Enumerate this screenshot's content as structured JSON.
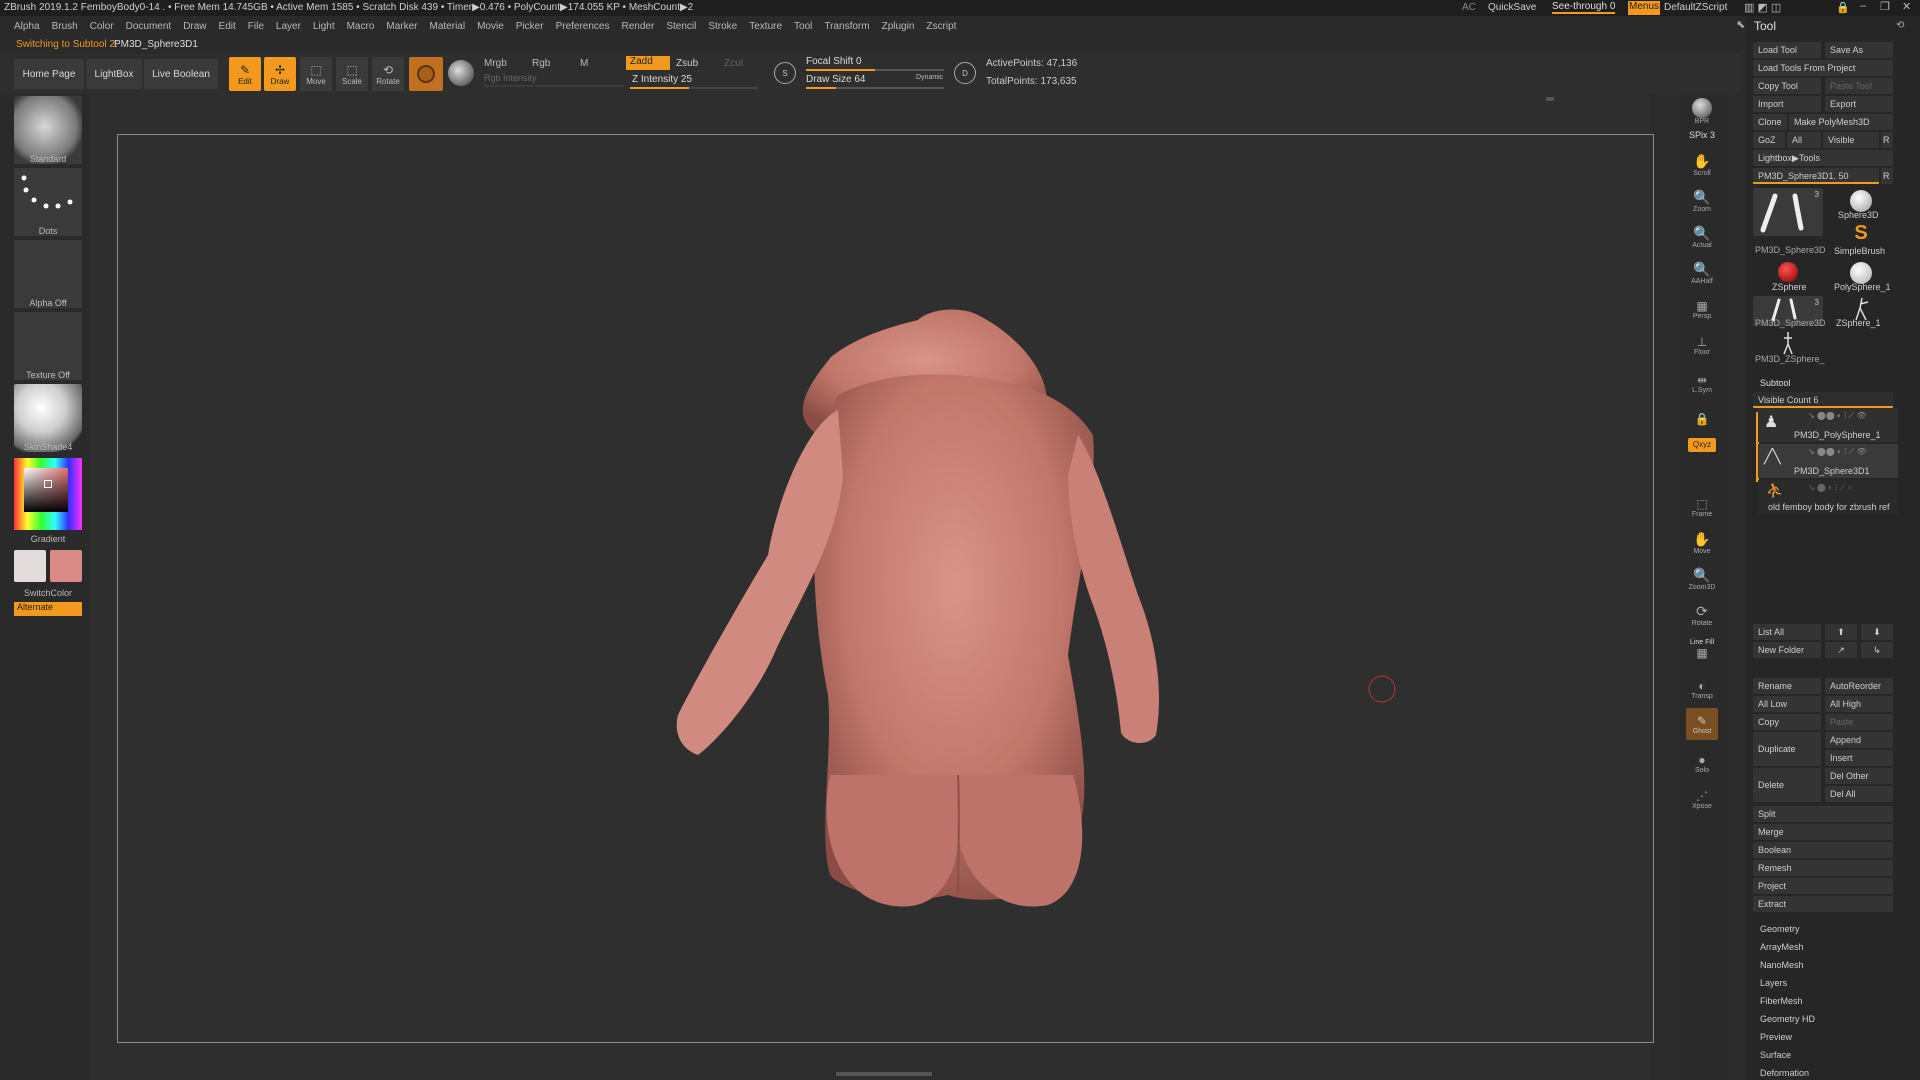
{
  "titlebar": {
    "title": "ZBrush 2019.1.2   FemboyBody0-14  . • Free Mem 14.745GB • Active Mem 1585 • Scratch Disk 439 • Timer▶0.476 • PolyCount▶174.055 KP • MeshCount▶2",
    "ac": "AC",
    "quicksave": "QuickSave",
    "seethrough": "See-through  0",
    "menus": "Menus",
    "defaultzscript": "DefaultZScript",
    "colors": {
      "accent": "#f39a1e",
      "bg": "#2b2b2b",
      "panel": "#262626"
    }
  },
  "menubar": [
    "Alpha",
    "Brush",
    "Color",
    "Document",
    "Draw",
    "Edit",
    "File",
    "Layer",
    "Light",
    "Macro",
    "Marker",
    "Material",
    "Movie",
    "Picker",
    "Preferences",
    "Render",
    "Stencil",
    "Stroke",
    "Texture",
    "Tool",
    "Transform",
    "Zplugin",
    "Zscript"
  ],
  "status": {
    "prefix": "Switching to Subtool 2:",
    "name": "PM3D_Sphere3D1"
  },
  "toolbar": {
    "home": "Home Page",
    "lightbox": "LightBox",
    "liveboolean": "Live Boolean",
    "edit": "Edit",
    "draw": "Draw",
    "move": "Move",
    "scale": "Scale",
    "rotate": "Rotate",
    "mrgb": "Mrgb",
    "rgb": "Rgb",
    "m": "M",
    "rgb_intensity": "Rgb Intensity",
    "zadd": "Zadd",
    "zsub": "Zsub",
    "zcut": "Zcut",
    "z_intensity": "Z Intensity 25",
    "z_intensity_value": 25,
    "focal_shift": "Focal Shift 0",
    "draw_size": "Draw Size 64",
    "draw_size_value": 64,
    "dynamic": "Dynamic",
    "active_points": "ActivePoints: 47,136",
    "total_points": "TotalPoints: 173,635"
  },
  "leftpanel": {
    "brush": "Standard",
    "stroke": "Dots",
    "alpha": "Alpha Off",
    "texture": "Texture Off",
    "material": "SkinShade4",
    "gradient": "Gradient",
    "switchcolor": "SwitchColor",
    "alternate": "Alternate"
  },
  "rightshelf": [
    {
      "icon": "bpr-icon",
      "label": "BPR"
    },
    {
      "icon": "spix-icon",
      "label": "SPix 3"
    },
    {
      "icon": "scroll-icon",
      "label": "Scroll"
    },
    {
      "icon": "zoom-icon",
      "label": "Zoom"
    },
    {
      "icon": "actual-icon",
      "label": "Actual"
    },
    {
      "icon": "aahalf-icon",
      "label": "AAHalf"
    },
    {
      "icon": "persp-icon",
      "label": "Persp"
    },
    {
      "icon": "floor-icon",
      "label": "Floor"
    },
    {
      "icon": "lsym-icon",
      "label": "L.Sym"
    },
    {
      "icon": "lock-icon",
      "label": ""
    },
    {
      "icon": "xyz-icon",
      "label": "Qxyz"
    },
    {
      "icon": "frame-icon",
      "label": "Frame"
    },
    {
      "icon": "move-icon",
      "label": "Move"
    },
    {
      "icon": "zoom3d-icon",
      "label": "Zoom3D"
    },
    {
      "icon": "rotate-icon",
      "label": "Rotate"
    },
    {
      "icon": "linefill-icon",
      "label": "Line Fill"
    },
    {
      "icon": "transp-icon",
      "label": "Transp"
    },
    {
      "icon": "ghost-icon",
      "label": "Ghost"
    },
    {
      "icon": "solo-icon",
      "label": "Solo"
    },
    {
      "icon": "xpose-icon",
      "label": "Xpose"
    }
  ],
  "toolpanel": {
    "title": "Tool",
    "load_tool": "Load Tool",
    "save_as": "Save As",
    "load_from_project": "Load Tools From Project",
    "copy_tool": "Copy Tool",
    "paste_tool": "Paste Tool",
    "import": "Import",
    "export": "Export",
    "clone": "Clone",
    "make_polymesh": "Make PolyMesh3D",
    "goz": "GoZ",
    "all": "All",
    "visible": "Visible",
    "r": "R",
    "lightbox_tools": "Lightbox▶Tools",
    "current_tool": "PM3D_Sphere3D1. 50",
    "tools": [
      {
        "name": "PM3D_Sphere3D",
        "count": "3"
      },
      {
        "name": "Sphere3D",
        "count": ""
      },
      {
        "name": "SimpleBrush",
        "count": ""
      },
      {
        "name": "ZSphere",
        "count": ""
      },
      {
        "name": "PolySphere_1",
        "count": ""
      },
      {
        "name": "PM3D_Sphere3D",
        "count": "3"
      },
      {
        "name": "ZSphere_1",
        "count": ""
      },
      {
        "name": "PM3D_ZSphere_",
        "count": ""
      }
    ],
    "subtool_title": "Subtool",
    "visible_count": "Visible Count 6",
    "subtools": [
      "PM3D_PolySphere_1",
      "PM3D_Sphere3D1",
      "old femboy body for zbrush ref"
    ],
    "list_all": "List All",
    "new_folder": "New Folder",
    "rename": "Rename",
    "autoreorder": "AutoReorder",
    "all_low": "All Low",
    "all_high": "All High",
    "copy": "Copy",
    "paste": "Paste",
    "duplicate": "Duplicate",
    "append": "Append",
    "insert": "Insert",
    "delete": "Delete",
    "del_other": "Del Other",
    "del_all": "Del All",
    "split": "Split",
    "merge": "Merge",
    "boolean": "Boolean",
    "remesh": "Remesh",
    "project": "Project",
    "extract": "Extract",
    "sections": [
      "Geometry",
      "ArrayMesh",
      "NanoMesh",
      "Layers",
      "FiberMesh",
      "Geometry HD",
      "Preview",
      "Surface",
      "Deformation"
    ]
  }
}
